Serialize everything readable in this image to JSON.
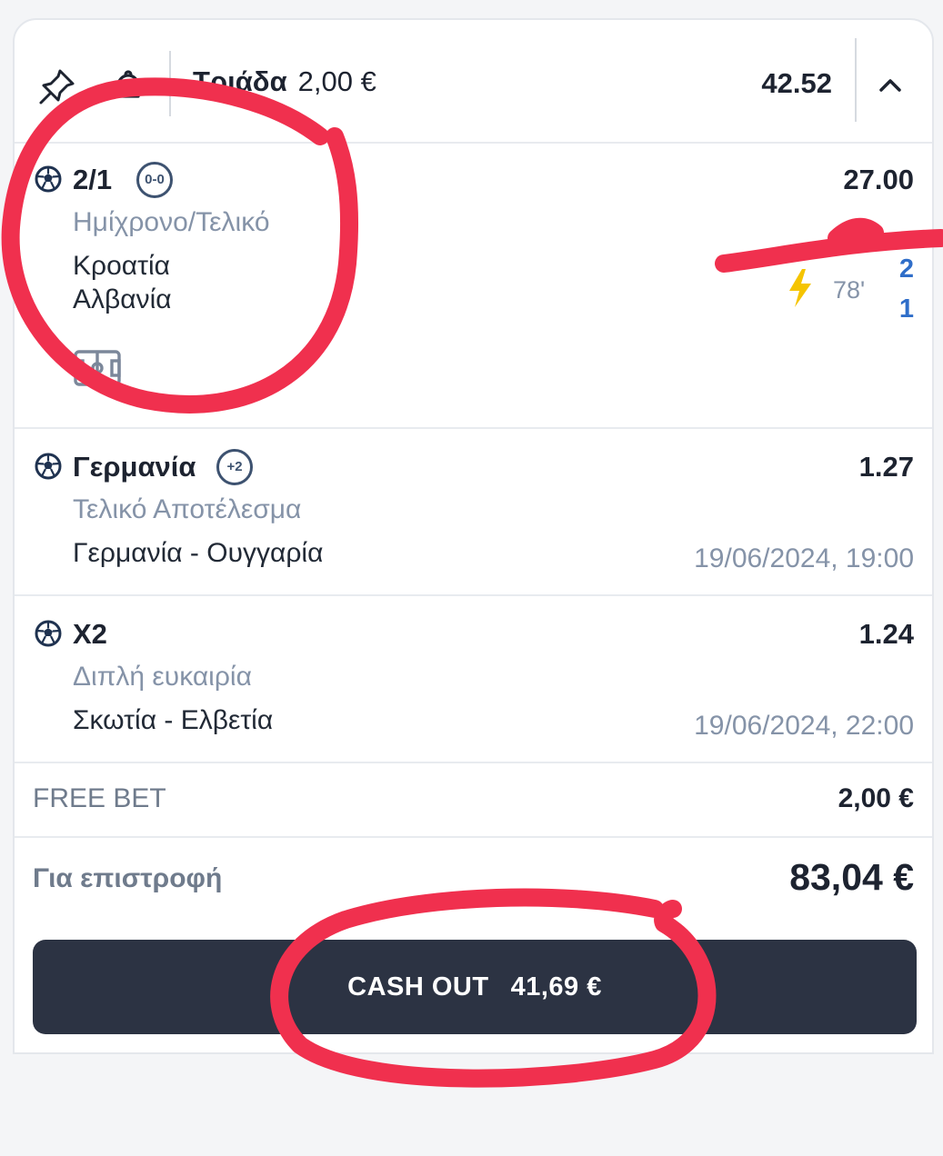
{
  "header": {
    "bet_type": "Τριάδα",
    "stake": "2,00 €",
    "total_odds": "42.52",
    "icons": [
      "pin-icon",
      "bell-icon",
      "chevron-up-icon"
    ]
  },
  "selections": [
    {
      "pick": "2/1",
      "badge": "0-0",
      "odds": "27.00",
      "market": "Ημίχρονο/Τελικό",
      "home": "Κροατία",
      "away": "Αλβανία",
      "live_minute": "78'",
      "home_score": "2",
      "away_score": "1"
    },
    {
      "pick": "Γερμανία",
      "badge": "+2",
      "odds": "1.27",
      "market": "Τελικό Αποτέλεσμα",
      "match": "Γερμανία - Ουγγαρία",
      "datetime": "19/06/2024, 19:00"
    },
    {
      "pick": "X2",
      "odds": "1.24",
      "market": "Διπλή ευκαιρία",
      "match": "Σκωτία - Ελβετία",
      "datetime": "19/06/2024, 22:00"
    }
  ],
  "free_bet": {
    "label": "FREE BET",
    "value": "2,00 €"
  },
  "returns": {
    "label": "Για επιστροφή",
    "value": "83,04 €"
  },
  "cashout": {
    "label": "CASH OUT",
    "amount": "41,69 €"
  },
  "colors": {
    "accent_dark": "#2c3343",
    "score_blue": "#2f6ec9",
    "annotation_red": "#f0304e",
    "live_yellow": "#f5c400"
  }
}
